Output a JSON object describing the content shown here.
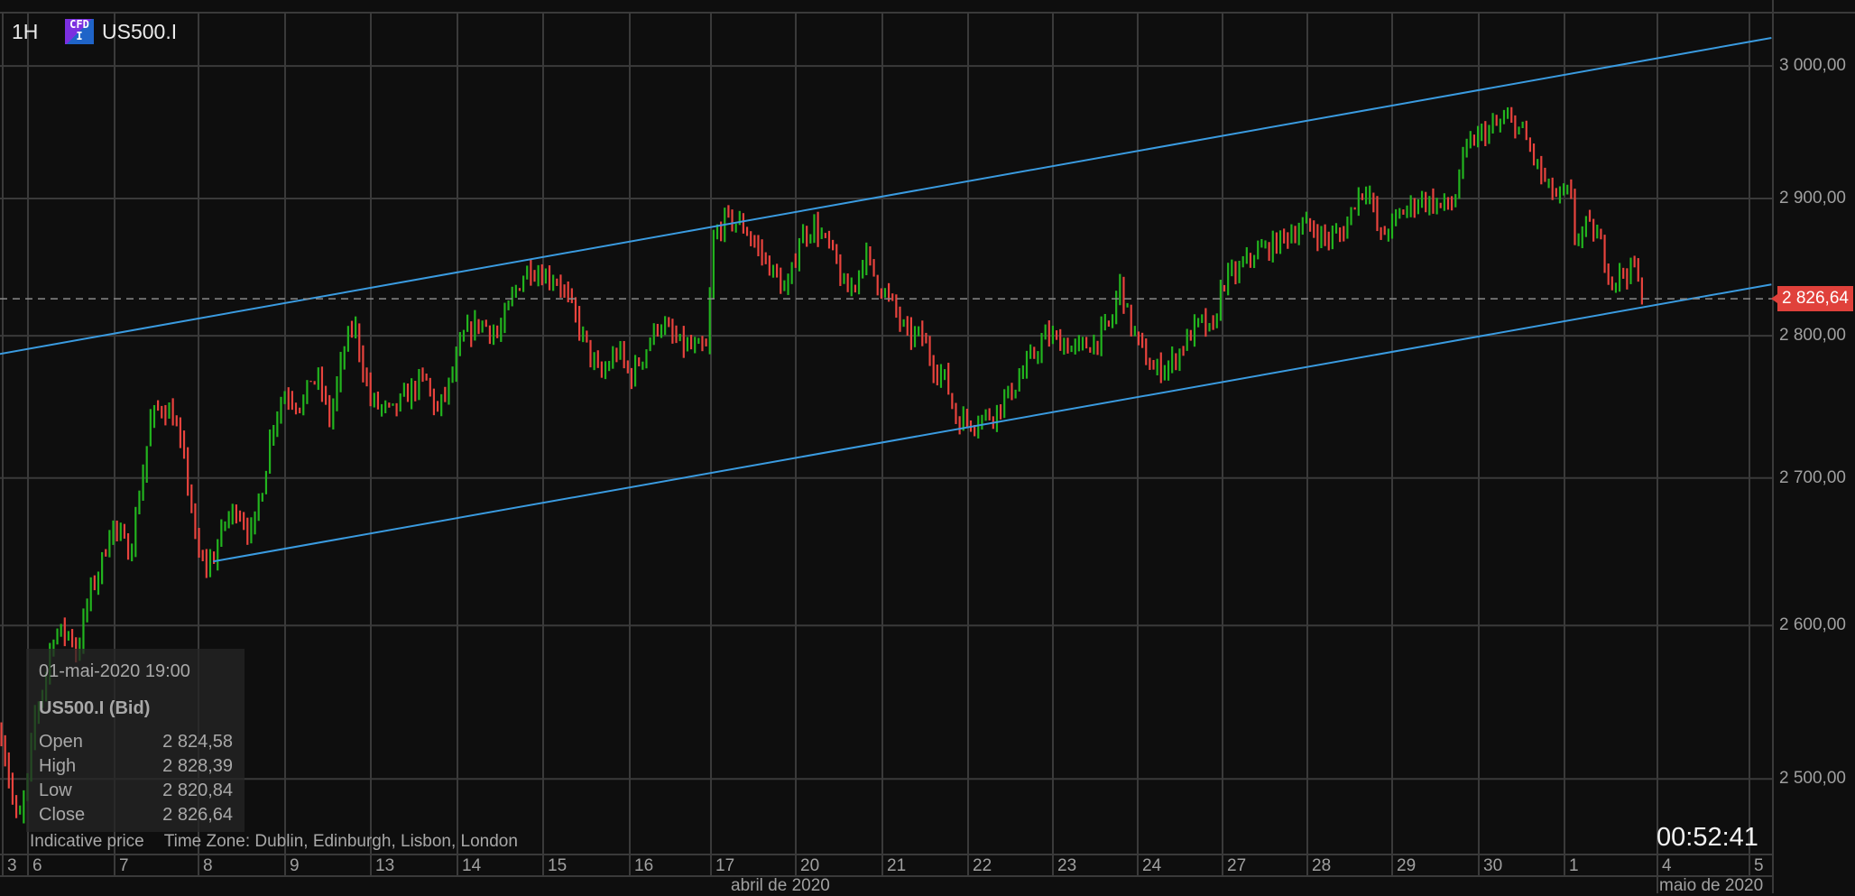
{
  "header": {
    "timeframe": "1H",
    "instrument_badge": "CFD I",
    "symbol": "US500.I"
  },
  "colors": {
    "background": "#0e0e0e",
    "grid": "#3a3a3a",
    "up": "#22b41e",
    "down": "#e8433d",
    "trendline": "#3a9be0",
    "last_price": "#e0413b"
  },
  "chart_data": {
    "type": "ohlc-bar",
    "scale": "log",
    "interval": "1H",
    "ylim": [
      2455,
      3035
    ],
    "y_ticks": [
      "3 000,00",
      "2 900,00",
      "2 800,00",
      "2 700,00",
      "2 600,00",
      "2 500,00"
    ],
    "y_tick_values": [
      3000,
      2900,
      2800,
      2700,
      2600,
      2500
    ],
    "last_price": 2826.64,
    "last_price_label": "2 826,64",
    "x_day_labels": [
      "3",
      "6",
      "7",
      "8",
      "9",
      "13",
      "14",
      "15",
      "16",
      "17",
      "20",
      "21",
      "22",
      "23",
      "24",
      "27",
      "28",
      "29",
      "30",
      "1",
      "4",
      "5"
    ],
    "x_month_labels": [
      "abril de 2020",
      "maio de 2020"
    ],
    "close_path_note_units": "[trading-day offset from 6 Apr, price]",
    "close_path": [
      [
        -0.31,
        2530
      ],
      [
        -0.12,
        2468
      ],
      [
        0,
        2500
      ],
      [
        0.08,
        2540
      ],
      [
        0.22,
        2570
      ],
      [
        0.29,
        2595
      ],
      [
        0.5,
        2595
      ],
      [
        0.57,
        2580
      ],
      [
        0.71,
        2620
      ],
      [
        0.85,
        2640
      ],
      [
        0.98,
        2670
      ],
      [
        1.05,
        2660
      ],
      [
        1.19,
        2650
      ],
      [
        1.33,
        2700
      ],
      [
        1.43,
        2740
      ],
      [
        1.54,
        2750
      ],
      [
        1.68,
        2745
      ],
      [
        1.75,
        2730
      ],
      [
        1.89,
        2690
      ],
      [
        1.96,
        2650
      ],
      [
        2.05,
        2640
      ],
      [
        2.16,
        2645
      ],
      [
        2.3,
        2670
      ],
      [
        2.44,
        2680
      ],
      [
        2.61,
        2660
      ],
      [
        2.75,
        2700
      ],
      [
        2.86,
        2740
      ],
      [
        3.0,
        2760
      ],
      [
        3.2,
        2750
      ],
      [
        3.3,
        2770
      ],
      [
        3.41,
        2765
      ],
      [
        3.52,
        2740
      ],
      [
        3.69,
        2790
      ],
      [
        3.8,
        2810
      ],
      [
        3.9,
        2780
      ],
      [
        3.99,
        2755
      ],
      [
        4.08,
        2750
      ],
      [
        4.24,
        2745
      ],
      [
        4.45,
        2760
      ],
      [
        4.63,
        2770
      ],
      [
        4.77,
        2745
      ],
      [
        4.94,
        2770
      ],
      [
        5.08,
        2800
      ],
      [
        5.28,
        2810
      ],
      [
        5.49,
        2800
      ],
      [
        5.66,
        2830
      ],
      [
        5.84,
        2850
      ],
      [
        5.98,
        2845
      ],
      [
        6.19,
        2840
      ],
      [
        6.37,
        2815
      ],
      [
        6.53,
        2790
      ],
      [
        6.67,
        2770
      ],
      [
        6.88,
        2790
      ],
      [
        7.02,
        2770
      ],
      [
        7.16,
        2785
      ],
      [
        7.36,
        2810
      ],
      [
        7.57,
        2795
      ],
      [
        7.78,
        2790
      ],
      [
        7.92,
        2790
      ],
      [
        7.99,
        2870
      ],
      [
        8.13,
        2885
      ],
      [
        8.34,
        2880
      ],
      [
        8.54,
        2860
      ],
      [
        8.75,
        2840
      ],
      [
        8.85,
        2830
      ],
      [
        8.99,
        2870
      ],
      [
        9.17,
        2880
      ],
      [
        9.38,
        2860
      ],
      [
        9.54,
        2830
      ],
      [
        9.65,
        2840
      ],
      [
        9.76,
        2860
      ],
      [
        9.89,
        2840
      ],
      [
        10.0,
        2830
      ],
      [
        10.1,
        2820
      ],
      [
        10.24,
        2800
      ],
      [
        10.42,
        2800
      ],
      [
        10.55,
        2780
      ],
      [
        10.69,
        2770
      ],
      [
        10.83,
        2740
      ],
      [
        11.04,
        2740
      ],
      [
        11.25,
        2745
      ],
      [
        11.46,
        2760
      ],
      [
        11.66,
        2780
      ],
      [
        11.87,
        2800
      ],
      [
        12.08,
        2795
      ],
      [
        12.22,
        2790
      ],
      [
        12.43,
        2795
      ],
      [
        12.64,
        2810
      ],
      [
        12.73,
        2840
      ],
      [
        12.84,
        2810
      ],
      [
        12.98,
        2790
      ],
      [
        13.12,
        2775
      ],
      [
        13.33,
        2780
      ],
      [
        13.54,
        2800
      ],
      [
        13.68,
        2810
      ],
      [
        13.81,
        2800
      ],
      [
        13.93,
        2840
      ],
      [
        14.09,
        2845
      ],
      [
        14.3,
        2860
      ],
      [
        14.51,
        2865
      ],
      [
        14.72,
        2875
      ],
      [
        14.92,
        2880
      ],
      [
        15.13,
        2870
      ],
      [
        15.34,
        2875
      ],
      [
        15.48,
        2900
      ],
      [
        15.62,
        2910
      ],
      [
        15.76,
        2870
      ],
      [
        15.89,
        2880
      ],
      [
        16.03,
        2890
      ],
      [
        16.24,
        2900
      ],
      [
        16.45,
        2895
      ],
      [
        16.62,
        2895
      ],
      [
        16.73,
        2930
      ],
      [
        16.87,
        2945
      ],
      [
        17.0,
        2950
      ],
      [
        17.14,
        2955
      ],
      [
        17.28,
        2960
      ],
      [
        17.42,
        2950
      ],
      [
        17.56,
        2930
      ],
      [
        17.7,
        2910
      ],
      [
        17.84,
        2900
      ],
      [
        17.98,
        2905
      ],
      [
        18.04,
        2870
      ],
      [
        18.18,
        2880
      ],
      [
        18.32,
        2870
      ],
      [
        18.46,
        2840
      ],
      [
        18.6,
        2845
      ],
      [
        18.74,
        2850
      ],
      [
        18.8,
        2830
      ],
      [
        18.86,
        2826.64
      ]
    ],
    "trendlines": [
      {
        "name": "upper-channel",
        "from": [
          -0.33,
          2787
        ],
        "to": [
          20.33,
          3021.6
        ]
      },
      {
        "name": "lower-channel",
        "from": [
          2.16,
          2643
        ],
        "to": [
          20.33,
          2837
        ]
      }
    ]
  },
  "tooltip": {
    "datetime": "01-mai-2020 19:00",
    "series": "US500.I (Bid)",
    "rows": [
      {
        "label": "Open",
        "value": "2 824,58"
      },
      {
        "label": "High",
        "value": "2 828,39"
      },
      {
        "label": "Low",
        "value": "2 820,84"
      },
      {
        "label": "Close",
        "value": "2 826,64"
      }
    ]
  },
  "footer": {
    "indicative": "Indicative price",
    "timezone": "Time Zone: Dublin, Edinburgh, Lisbon, London"
  },
  "countdown": "00:52:41"
}
